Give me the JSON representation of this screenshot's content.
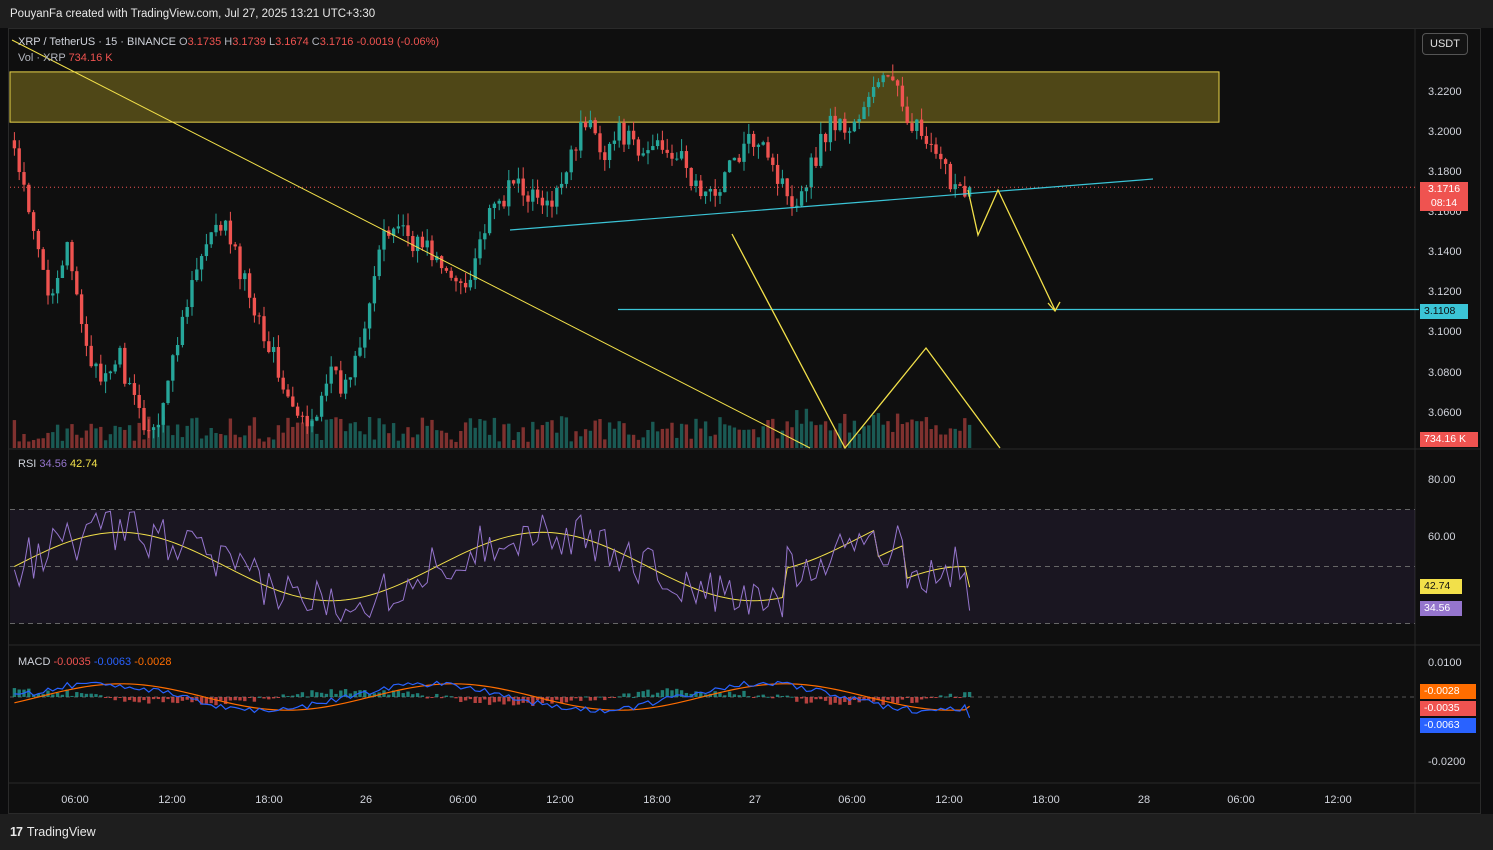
{
  "header": {
    "attribution": "PouyanFa created with TradingView.com, Jul 27, 2025 13:21 UTC+3:30"
  },
  "legend": {
    "symbol": "XRP / TetherUS · 15 · BINANCE",
    "o_label": "O",
    "o_value": "3.1735",
    "h_label": "H",
    "h_value": "3.1739",
    "l_label": "L",
    "l_value": "3.1674",
    "c_label": "C",
    "c_value": "3.1716",
    "change": "-0.0019 (-0.06%)",
    "vol_label": "Vol · XRP",
    "vol_value": "734.16 K"
  },
  "currency_button": "USDT",
  "price_badges": {
    "last_price": "3.1716",
    "countdown": "08:14",
    "support_level": "3.1108",
    "volume": "734.16 K"
  },
  "rsi": {
    "label": "RSI",
    "value": "34.56",
    "ma_value": "42.74"
  },
  "macd": {
    "label": "MACD",
    "hist": "-0.0035",
    "macd": "-0.0063",
    "signal": "-0.0028",
    "badge_signal": "-0.0028",
    "badge_hist": "-0.0035",
    "badge_macd": "-0.0063"
  },
  "footer": {
    "logo_mark": "17",
    "brand": "TradingView"
  },
  "colors": {
    "up": "#26a69a",
    "down": "#ef5350",
    "trend": "#f2e04a",
    "support": "#3bc4d6",
    "rsi_line": "#9575cd",
    "rsi_ma": "#f2e04a",
    "macd_line": "#2962ff",
    "signal_line": "#ff6d00"
  },
  "chart_data": [
    {
      "type": "candlestick",
      "title": "XRP / TetherUS · 15 · BINANCE",
      "price_axis_ticks": [
        "3.2200",
        "3.2000",
        "3.1800",
        "3.1600",
        "3.1400",
        "3.1200",
        "3.1000",
        "3.0800",
        "3.0600"
      ],
      "time_axis_ticks": [
        "06:00",
        "12:00",
        "18:00",
        "26",
        "06:00",
        "12:00",
        "18:00",
        "27",
        "06:00",
        "12:00",
        "18:00",
        "28",
        "06:00",
        "12:00"
      ],
      "ylim": [
        3.042,
        3.245
      ],
      "close_path": [
        3.19,
        3.15,
        3.12,
        3.14,
        3.1,
        3.07,
        3.09,
        3.06,
        3.05,
        3.08,
        3.12,
        3.14,
        3.155,
        3.13,
        3.11,
        3.085,
        3.06,
        3.05,
        3.08,
        3.07,
        3.1,
        3.14,
        3.155,
        3.145,
        3.14,
        3.125,
        3.125,
        3.15,
        3.165,
        3.175,
        3.165,
        3.16,
        3.19,
        3.205,
        3.19,
        3.2,
        3.185,
        3.195,
        3.19,
        3.175,
        3.165,
        3.18,
        3.19,
        3.2,
        3.175,
        3.165,
        3.185,
        3.205,
        3.2,
        3.21,
        3.23,
        3.215,
        3.2,
        3.185,
        3.175,
        3.1716
      ],
      "annotations": {
        "resistance_zone": [
          3.204,
          3.229
        ],
        "support_line": 3.1108,
        "last_price": 3.1716
      }
    },
    {
      "type": "line",
      "title": "RSI",
      "series": [
        {
          "name": "RSI",
          "last": 34.56
        },
        {
          "name": "MA",
          "last": 42.74
        }
      ],
      "ticks": [
        "80.00",
        "60.00"
      ],
      "bands": [
        70,
        50,
        30
      ],
      "ylim": [
        25,
        85
      ]
    },
    {
      "type": "line",
      "title": "MACD",
      "series": [
        {
          "name": "Histogram",
          "last": -0.0035
        },
        {
          "name": "MACD",
          "last": -0.0063
        },
        {
          "name": "Signal",
          "last": -0.0028
        }
      ],
      "ticks": [
        "0.0100",
        "-0.0200"
      ],
      "ylim": [
        -0.025,
        0.012
      ]
    }
  ]
}
